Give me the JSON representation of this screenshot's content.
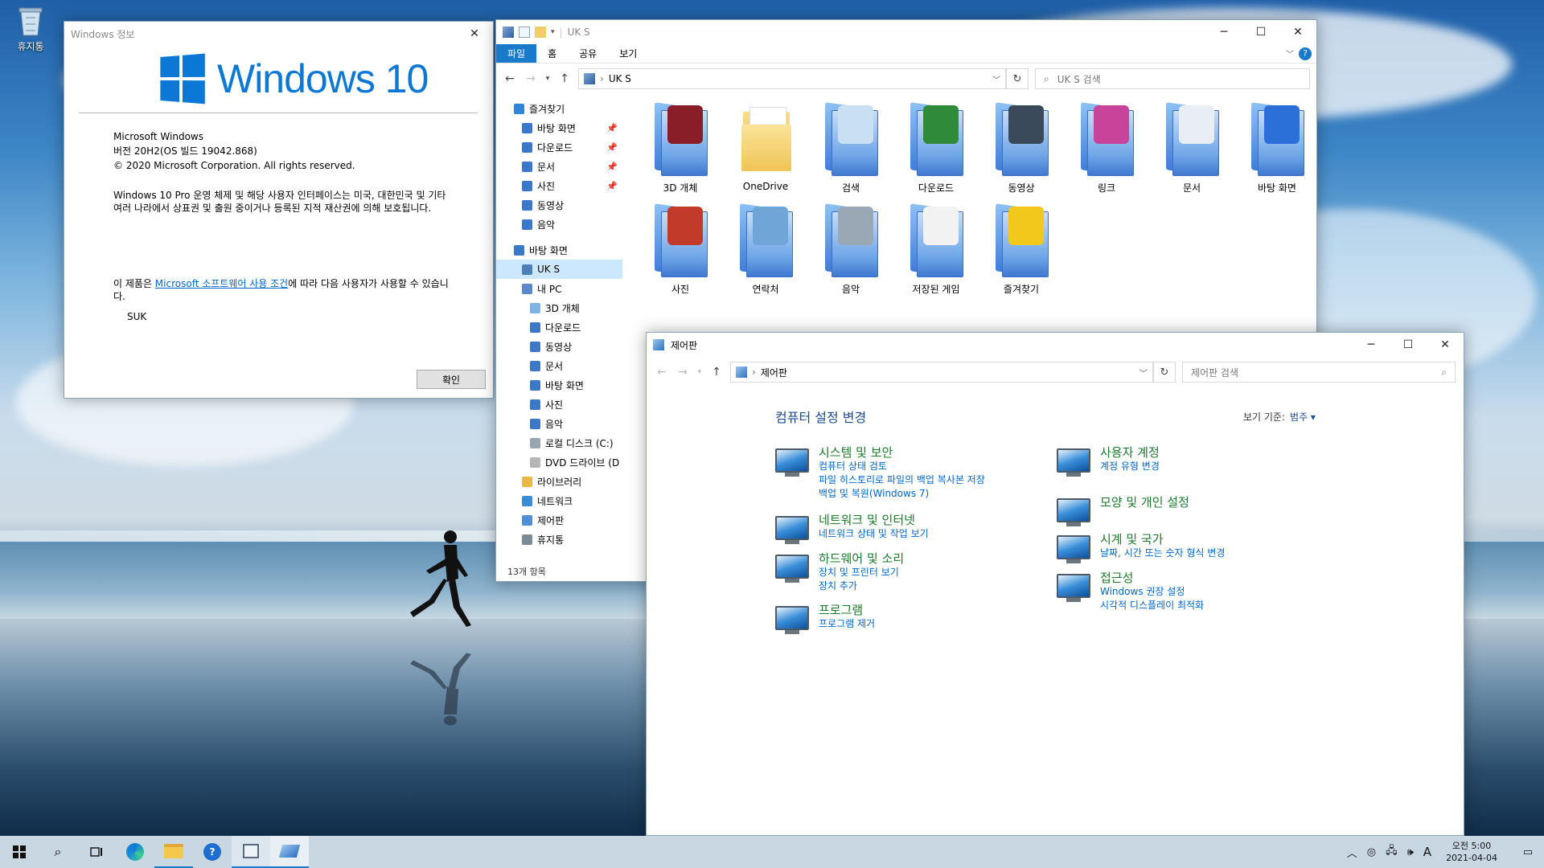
{
  "desktop": {
    "recycle_bin": "휴지통"
  },
  "about": {
    "title": "Windows 정보",
    "logo_text": "Windows 10",
    "info": [
      "Microsoft Windows",
      "버전 20H2(OS 빌드 19042.868)",
      "© 2020 Microsoft Corporation. All rights reserved."
    ],
    "para": "Windows 10 Pro 운영 체제 및 해당 사용자 인터페이스는 미국, 대한민국 및 기타 여러 나라에서 상표권 및 출원 중이거나 등록된 지적 재산권에 의해 보호됩니다.",
    "license_pre": "이 제품은 ",
    "license_link": "Microsoft 소프트웨어 사용 조건",
    "license_post": "에 따라 다음 사용자가 사용할 수 있습니다.",
    "user": "SUK",
    "ok": "확인"
  },
  "explorer": {
    "title": "UK S",
    "tabs": [
      "파일",
      "홈",
      "공유",
      "보기"
    ],
    "help": "?",
    "address": "UK S",
    "search_placeholder": "UK S 검색",
    "nav": [
      {
        "label": "즐겨찾기",
        "indent": 0,
        "color": "#2f86d8",
        "pin": false,
        "sel": false
      },
      {
        "label": "바탕 화면",
        "indent": 1,
        "color": "#3c78c8",
        "pin": true,
        "sel": false
      },
      {
        "label": "다운로드",
        "indent": 1,
        "color": "#3c78c8",
        "pin": true,
        "sel": false
      },
      {
        "label": "문서",
        "indent": 1,
        "color": "#3c78c8",
        "pin": true,
        "sel": false
      },
      {
        "label": "사진",
        "indent": 1,
        "color": "#3c78c8",
        "pin": true,
        "sel": false
      },
      {
        "label": "동영상",
        "indent": 1,
        "color": "#3c78c8",
        "pin": false,
        "sel": false
      },
      {
        "label": "음악",
        "indent": 1,
        "color": "#3c78c8",
        "pin": false,
        "sel": false
      },
      {
        "label": "바탕 화면",
        "indent": 0,
        "color": "#3c78c8",
        "pin": false,
        "sel": false,
        "gap": true
      },
      {
        "label": "UK S",
        "indent": 1,
        "color": "#4d7fb8",
        "pin": false,
        "sel": true
      },
      {
        "label": "내 PC",
        "indent": 1,
        "color": "#5a8ac8",
        "pin": false,
        "sel": false
      },
      {
        "label": "3D 개체",
        "indent": 2,
        "color": "#7fb3e6",
        "pin": false,
        "sel": false
      },
      {
        "label": "다운로드",
        "indent": 2,
        "color": "#3c78c8",
        "pin": false,
        "sel": false
      },
      {
        "label": "동영상",
        "indent": 2,
        "color": "#3c78c8",
        "pin": false,
        "sel": false
      },
      {
        "label": "문서",
        "indent": 2,
        "color": "#3c78c8",
        "pin": false,
        "sel": false
      },
      {
        "label": "바탕 화면",
        "indent": 2,
        "color": "#3c78c8",
        "pin": false,
        "sel": false
      },
      {
        "label": "사진",
        "indent": 2,
        "color": "#3c78c8",
        "pin": false,
        "sel": false
      },
      {
        "label": "음악",
        "indent": 2,
        "color": "#3c78c8",
        "pin": false,
        "sel": false
      },
      {
        "label": "로컬 디스크 (C:)",
        "indent": 2,
        "color": "#9aa5af",
        "pin": false,
        "sel": false
      },
      {
        "label": "DVD 드라이브 (D",
        "indent": 2,
        "color": "#b5b5b5",
        "pin": false,
        "sel": false
      },
      {
        "label": "라이브러리",
        "indent": 1,
        "color": "#e8b949",
        "pin": false,
        "sel": false
      },
      {
        "label": "네트워크",
        "indent": 1,
        "color": "#3d8cd6",
        "pin": false,
        "sel": false
      },
      {
        "label": "제어판",
        "indent": 1,
        "color": "#4f8fd4",
        "pin": false,
        "sel": false
      },
      {
        "label": "휴지통",
        "indent": 1,
        "color": "#7c8a96",
        "pin": false,
        "sel": false
      }
    ],
    "status": "13개 항목",
    "items": [
      {
        "label": "3D 개체",
        "art": "#8a1e28",
        "kind": "folder"
      },
      {
        "label": "OneDrive",
        "art": "#f5d06a",
        "kind": "yellow"
      },
      {
        "label": "검색",
        "art": "#c9dff2",
        "kind": "folder"
      },
      {
        "label": "다운로드",
        "art": "#2f8a3a",
        "kind": "folder"
      },
      {
        "label": "동영상",
        "art": "#3b4a5a",
        "kind": "folder"
      },
      {
        "label": "링크",
        "art": "#c8449a",
        "kind": "folder"
      },
      {
        "label": "문서",
        "art": "#e9eef4",
        "kind": "folder"
      },
      {
        "label": "바탕 화면",
        "art": "#2b6fd8",
        "kind": "folder"
      },
      {
        "label": "사진",
        "art": "#c23a2a",
        "kind": "folder"
      },
      {
        "label": "연락처",
        "art": "#6ea6d8",
        "kind": "folder"
      },
      {
        "label": "음악",
        "art": "#9aa8b6",
        "kind": "folder"
      },
      {
        "label": "저장된 게임",
        "art": "#f2f2f2",
        "kind": "folder"
      },
      {
        "label": "즐겨찾기",
        "art": "#f3c81d",
        "kind": "folder"
      }
    ]
  },
  "cpanel": {
    "title": "제어판",
    "address": "제어판",
    "search_placeholder": "제어판 검색",
    "heading": "컴퓨터 설정 변경",
    "view_label": "보기 기준:",
    "view_value": "범주 ▾",
    "left": [
      {
        "title": "시스템 및 보안",
        "links": [
          "컴퓨터 상태 검토",
          "파일 히스토리로 파일의 백업 복사본 저장",
          "백업 및 복원(Windows 7)"
        ]
      },
      {
        "title": "네트워크 및 인터넷",
        "links": [
          "네트워크 상태 및 작업 보기"
        ]
      },
      {
        "title": "하드웨어 및 소리",
        "links": [
          "장치 및 프린터 보기",
          "장치 추가"
        ]
      },
      {
        "title": "프로그램",
        "links": [
          "프로그램 제거"
        ]
      }
    ],
    "right": [
      {
        "title": "사용자 계정",
        "links": [
          "계정 유형 변경"
        ]
      },
      {
        "title": "모양 및 개인 설정",
        "links": []
      },
      {
        "title": "시계 및 국가",
        "links": [
          "날짜, 시간 또는 숫자 형식 변경"
        ]
      },
      {
        "title": "접근성",
        "links": [
          "Windows 권장 설정",
          "시각적 디스플레이 최적화"
        ]
      }
    ]
  },
  "taskbar": {
    "time": "오전 5:00",
    "date": "2021-04-04",
    "ime": "A",
    "help_icon": "?"
  }
}
